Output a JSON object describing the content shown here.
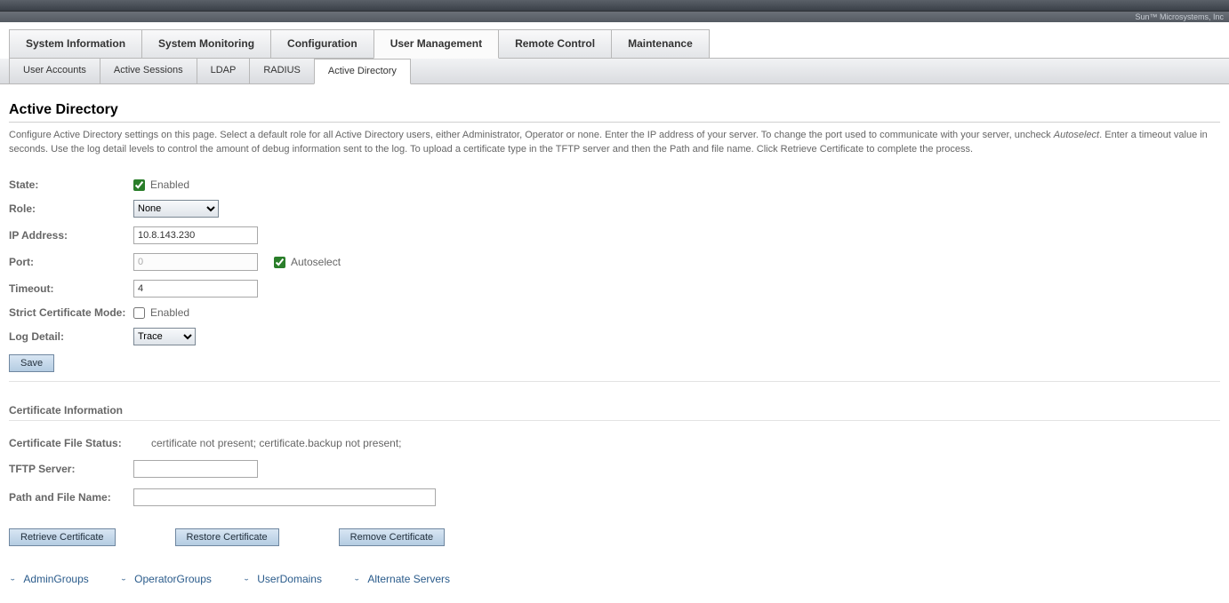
{
  "brand": "Sun™ Microsystems, Inc",
  "mainTabs": {
    "t0": "System Information",
    "t1": "System Monitoring",
    "t2": "Configuration",
    "t3": "User Management",
    "t4": "Remote Control",
    "t5": "Maintenance"
  },
  "subTabs": {
    "s0": "User Accounts",
    "s1": "Active Sessions",
    "s2": "LDAP",
    "s3": "RADIUS",
    "s4": "Active Directory"
  },
  "page": {
    "title": "Active Directory",
    "descriptionA": "Configure Active Directory settings on this page. Select a default role for all Active Directory users, either Administrator, Operator or none. Enter the IP address of your server. To change the port used to communicate with your server, uncheck ",
    "descriptionItalic": "Autoselect",
    "descriptionB": ". Enter a timeout value in seconds. Use the log detail levels to control the amount of debug information sent to the log. To upload a certificate type in the TFTP server and then the Path and file name. Click Retrieve Certificate to complete the process."
  },
  "form": {
    "stateLabel": "State:",
    "stateEnabledLabel": "Enabled",
    "stateChecked": true,
    "roleLabel": "Role:",
    "roleValue": "None",
    "ipLabel": "IP Address:",
    "ipValue": "10.8.143.230",
    "portLabel": "Port:",
    "portValue": "0",
    "autoselectLabel": "Autoselect",
    "autoselectChecked": true,
    "timeoutLabel": "Timeout:",
    "timeoutValue": "4",
    "strictLabel": "Strict Certificate Mode:",
    "strictEnabledLabel": "Enabled",
    "strictChecked": false,
    "logLabel": "Log Detail:",
    "logValue": "Trace",
    "saveLabel": "Save"
  },
  "cert": {
    "sectionTitle": "Certificate Information",
    "statusLabel": "Certificate File Status:",
    "statusValue": "certificate not present; certificate.backup not present;",
    "tftpLabel": "TFTP Server:",
    "tftpValue": "",
    "pathLabel": "Path and File Name:",
    "pathValue": "",
    "retrieveLabel": "Retrieve Certificate",
    "restoreLabel": "Restore Certificate",
    "removeLabel": "Remove Certificate"
  },
  "links": {
    "l0": "AdminGroups",
    "l1": "OperatorGroups",
    "l2": "UserDomains",
    "l3": "Alternate Servers"
  }
}
